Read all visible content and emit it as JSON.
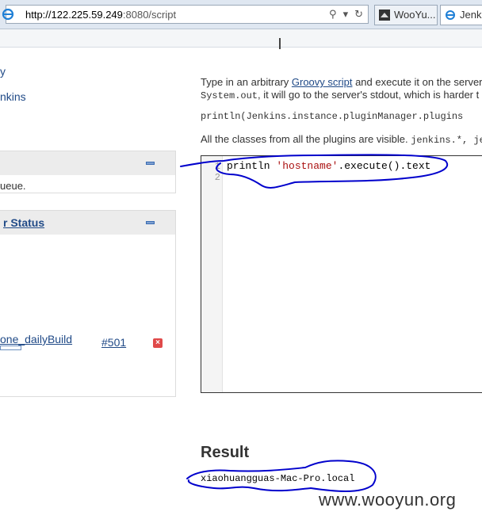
{
  "browser": {
    "url_host": "http://122.225.59.249",
    "url_rest": ":8080/script",
    "search_glyph": "⚲",
    "dropdown_glyph": "▾",
    "refresh_glyph": "↻",
    "tabs": [
      {
        "label": "WooYu..."
      },
      {
        "label": "Jenki"
      }
    ]
  },
  "sidebar": {
    "links": [
      "y",
      "nkins"
    ],
    "panel_queue": {
      "text": "ueue."
    },
    "panel_executor": {
      "title": "r Status",
      "job_name": "one_dailyBuild",
      "build_number": "#501",
      "stop_glyph": "×"
    }
  },
  "main": {
    "intro_prefix": "Type in an arbitrary ",
    "intro_link": "Groovy script",
    "intro_suffix": " and execute it on the server",
    "line2_code": "System.out",
    "line2_text": ", it will go to the server's stdout, which is harder t",
    "example_code": "println(Jenkins.instance.pluginManager.plugins",
    "classes_text": "All the classes from all the plugins are visible. ",
    "classes_code": "jenkins.*, je",
    "editor": {
      "line_numbers": [
        "1",
        "2"
      ],
      "code_prefix": "println ",
      "code_string": "'hostname'",
      "code_suffix": ".execute().text"
    },
    "result_heading": "Result",
    "result_value": "xiaohuangguas-Mac-Pro.local"
  },
  "watermark": "www.wooyun.org",
  "colors": {
    "link": "#204a87",
    "annotation": "#0000cc",
    "string": "#aa1111"
  }
}
